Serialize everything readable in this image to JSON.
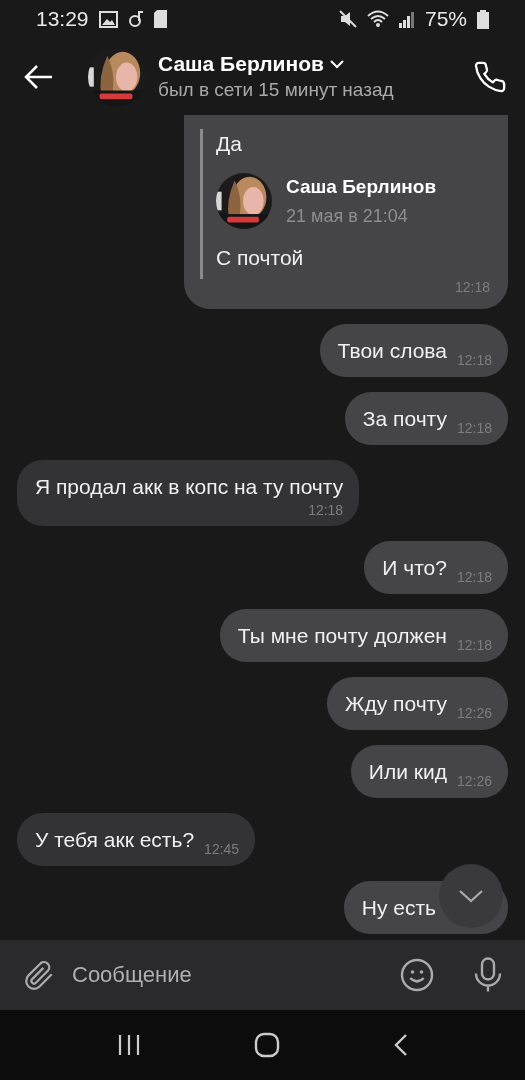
{
  "status_bar": {
    "time": "13:29",
    "battery": "75%"
  },
  "header": {
    "name": "Саша Берлинов",
    "status": "был в сети 15 минут назад"
  },
  "messages": [
    {
      "kind": "forwarded",
      "outgoing": true,
      "top_text": "Да",
      "author": "Саша Берлинов",
      "date": "21 мая в 21:04",
      "text": "С почтой",
      "time": "12:18"
    },
    {
      "kind": "text",
      "outgoing": true,
      "text": "Твои слова",
      "time": "12:18"
    },
    {
      "kind": "text",
      "outgoing": true,
      "text": "За почту",
      "time": "12:18"
    },
    {
      "kind": "text",
      "outgoing": false,
      "text": "Я продал акк в копс на ту почту",
      "time": "12:18",
      "wrap": true
    },
    {
      "kind": "text",
      "outgoing": true,
      "text": "И что?",
      "time": "12:18"
    },
    {
      "kind": "text",
      "outgoing": true,
      "text": "Ты мне почту должен",
      "time": "12:18"
    },
    {
      "kind": "text",
      "outgoing": true,
      "text": "Жду почту",
      "time": "12:26"
    },
    {
      "kind": "text",
      "outgoing": true,
      "text": "Или кид",
      "time": "12:26"
    },
    {
      "kind": "text",
      "outgoing": false,
      "text": "У тебя акк есть?",
      "time": "12:45"
    },
    {
      "kind": "text",
      "outgoing": true,
      "text": "Ну есть"
    }
  ],
  "composer": {
    "placeholder": "Сообщение"
  }
}
